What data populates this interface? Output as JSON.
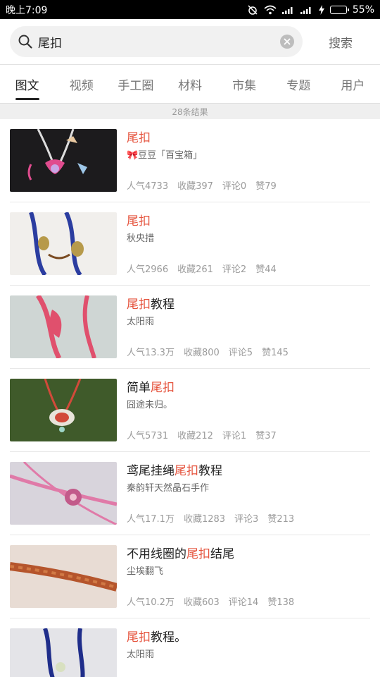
{
  "status": {
    "time": "晚上7:09",
    "battery": "55%",
    "battery_level": 0.55
  },
  "search": {
    "query": "尾扣",
    "submit_label": "搜索"
  },
  "tabs": [
    "图文",
    "视频",
    "手工圈",
    "材料",
    "市集",
    "专题",
    "用户"
  ],
  "active_tab": 0,
  "result_count": "28条结果",
  "results": [
    {
      "title_pre": "",
      "title_hl": "尾扣",
      "title_post": "",
      "author": "🎀豆豆「百宝箱」",
      "popularity": "人气4733",
      "favorites": "收藏397",
      "comments": "评论0",
      "likes": "赞79"
    },
    {
      "title_pre": "",
      "title_hl": "尾扣",
      "title_post": "",
      "author": "秋央措",
      "popularity": "人气2966",
      "favorites": "收藏261",
      "comments": "评论2",
      "likes": "赞44"
    },
    {
      "title_pre": "",
      "title_hl": "尾扣",
      "title_post": "教程",
      "author": "太阳雨",
      "popularity": "人气13.3万",
      "favorites": "收藏800",
      "comments": "评论5",
      "likes": "赞145"
    },
    {
      "title_pre": "简单",
      "title_hl": "尾扣",
      "title_post": "",
      "author": "囧途未归。",
      "popularity": "人气5731",
      "favorites": "收藏212",
      "comments": "评论1",
      "likes": "赞37"
    },
    {
      "title_pre": "鸢尾挂绳",
      "title_hl": "尾扣",
      "title_post": "教程",
      "author": "秦韵轩天然晶石手作",
      "popularity": "人气17.1万",
      "favorites": "收藏1283",
      "comments": "评论3",
      "likes": "赞213"
    },
    {
      "title_pre": "不用线圈的",
      "title_hl": "尾扣",
      "title_post": "结尾",
      "author": "尘埃翻飞",
      "popularity": "人气10.2万",
      "favorites": "收藏603",
      "comments": "评论14",
      "likes": "赞138"
    },
    {
      "title_pre": "",
      "title_hl": "尾扣",
      "title_post": "教程。",
      "author": "太阳雨",
      "popularity": "",
      "favorites": "",
      "comments": "",
      "likes": ""
    }
  ],
  "colors": {
    "highlight": "#e5533d",
    "battery_green": "#5ac84a"
  }
}
